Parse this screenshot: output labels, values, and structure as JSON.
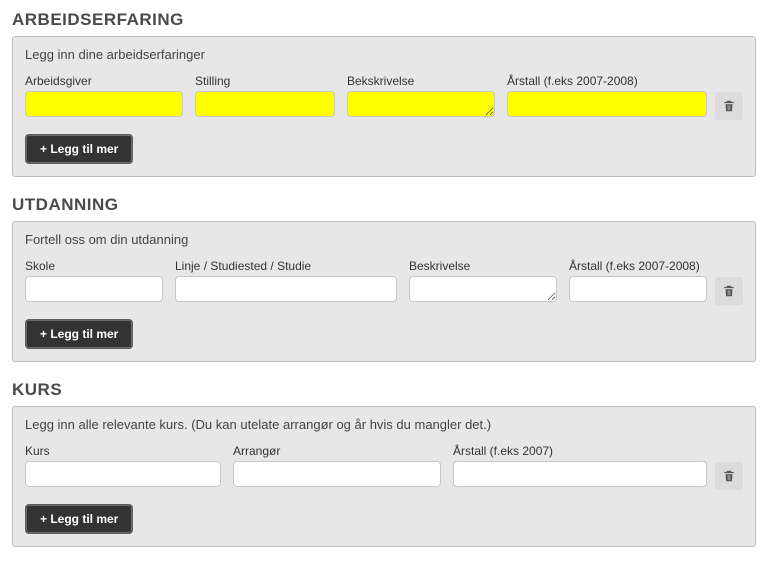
{
  "colors": {
    "highlight": "#ffff00",
    "panel_bg": "#e7e7e7",
    "panel_border": "#bdbdbd",
    "btn_bg": "#333333",
    "btn_fg": "#ffffff"
  },
  "shared": {
    "add_more_label": "+ Legg til mer"
  },
  "experience": {
    "title": "ARBEIDSERFARING",
    "description": "Legg inn dine arbeidserfaringer",
    "labels": {
      "employer": "Arbeidsgiver",
      "position": "Stilling",
      "description": "Bekskrivelse",
      "year": "Årstall (f.eks 2007-2008)"
    },
    "row": {
      "employer": "",
      "position": "",
      "description": "",
      "year": ""
    },
    "highlight": true
  },
  "education": {
    "title": "UTDANNING",
    "description": "Fortell oss om din utdanning",
    "labels": {
      "school": "Skole",
      "line": "Linje / Studiested / Studie",
      "description": "Beskrivelse",
      "year": "Årstall (f.eks 2007-2008)"
    },
    "row": {
      "school": "",
      "line": "",
      "description": "",
      "year": ""
    },
    "highlight": false
  },
  "courses": {
    "title": "KURS",
    "description": "Legg inn alle relevante kurs. (Du kan utelate arrangør og år hvis du mangler det.)",
    "labels": {
      "course": "Kurs",
      "organizer": "Arrangør",
      "year": "Årstall (f.eks 2007)"
    },
    "row": {
      "course": "",
      "organizer": "",
      "year": ""
    },
    "highlight": false
  }
}
